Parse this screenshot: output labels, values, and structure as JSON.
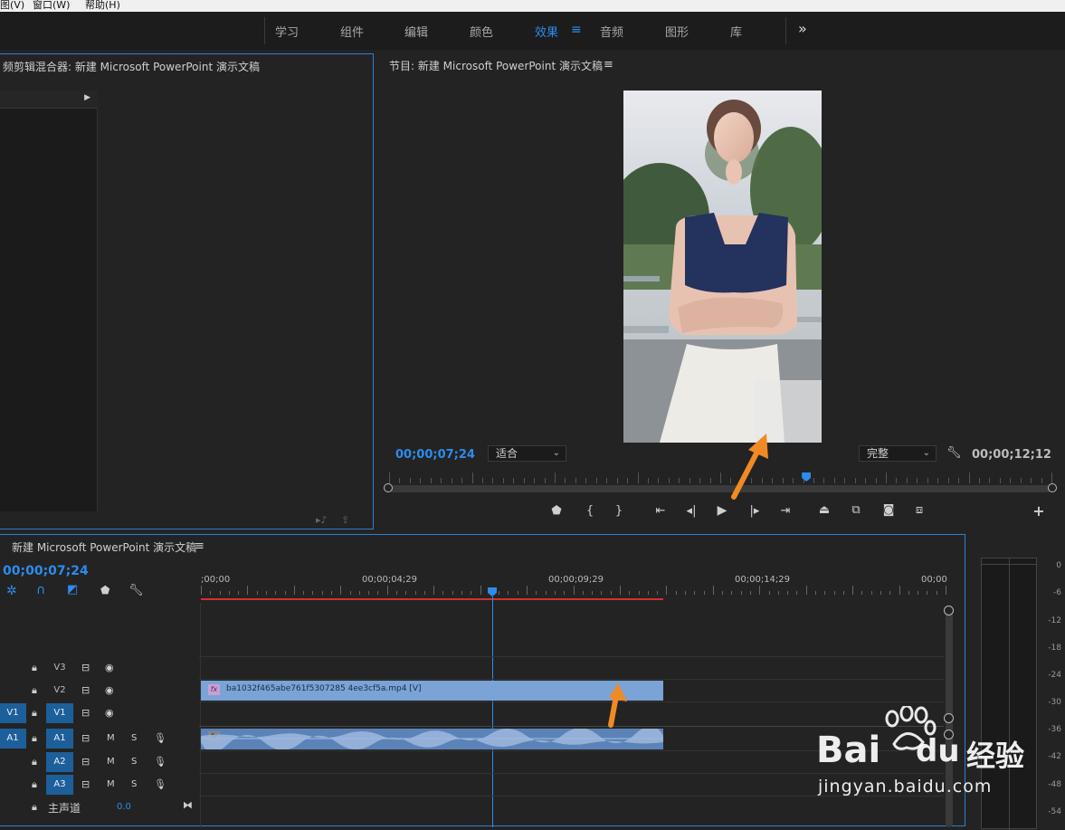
{
  "menubar": {
    "items": [
      "图(V)",
      "窗口(W)",
      "帮助(H)"
    ]
  },
  "workspaces": {
    "tabs": [
      {
        "label": "学习",
        "active": false
      },
      {
        "label": "组件",
        "active": false
      },
      {
        "label": "编辑",
        "active": false
      },
      {
        "label": "颜色",
        "active": false
      },
      {
        "label": "效果",
        "active": true
      },
      {
        "label": "音频",
        "active": false
      },
      {
        "label": "图形",
        "active": false
      },
      {
        "label": "库",
        "active": false
      }
    ],
    "overflow": "»",
    "menu_icon": "≡"
  },
  "mixer_panel": {
    "title": "频剪辑混合器: 新建 Microsoft PowerPoint 演示文稿"
  },
  "program_monitor": {
    "title": "节目: 新建 Microsoft PowerPoint 演示文稿",
    "menu_icon": "≡",
    "current_timecode": "00;00;07;24",
    "fit_dropdown": "适合",
    "quality_dropdown": "完整",
    "duration_timecode": "00;00;12;12",
    "playhead_fraction": 0.63
  },
  "timeline": {
    "title": "新建 Microsoft PowerPoint 演示文稿",
    "menu_icon": "≡",
    "current_timecode": "00;00;07;24",
    "ruler_labels": [
      ";00;00",
      "00;00;04;29",
      "00;00;09;29",
      "00;00;14;29",
      "00;00"
    ],
    "tracks": [
      {
        "source": "",
        "name": "V3",
        "type": "video"
      },
      {
        "source": "",
        "name": "V2",
        "type": "video"
      },
      {
        "source": "V1",
        "name": "V1",
        "type": "video"
      },
      {
        "source": "A1",
        "name": "A1",
        "type": "audio"
      },
      {
        "source": "",
        "name": "A2",
        "type": "audio"
      },
      {
        "source": "",
        "name": "A3",
        "type": "audio"
      }
    ],
    "mute_label": "M",
    "solo_label": "S",
    "master": {
      "label": "主声道",
      "value": "0.0"
    },
    "video_clip": {
      "label": "ba1032f465abe761f5307285 4ee3cf5a.mp4 [V]",
      "fx": "fx"
    },
    "audio_clip": {
      "fx": "fx"
    }
  },
  "audio_meter": {
    "ticks": [
      "0",
      "-6",
      "-12",
      "-18",
      "-24",
      "-30",
      "-36",
      "-42",
      "-48",
      "-54"
    ]
  },
  "watermark": {
    "brand": "Bai",
    "brand2": "du",
    "brand_cn": "经验",
    "url": "jingyan.baidu.com"
  },
  "colors": {
    "accent": "#2d8ceb",
    "panel_border": "#2d7fd2",
    "clip_video": "#7aa3d6",
    "clip_audio": "#5b83b8",
    "arrow": "#f08a24",
    "work_area": "#d0322a"
  }
}
